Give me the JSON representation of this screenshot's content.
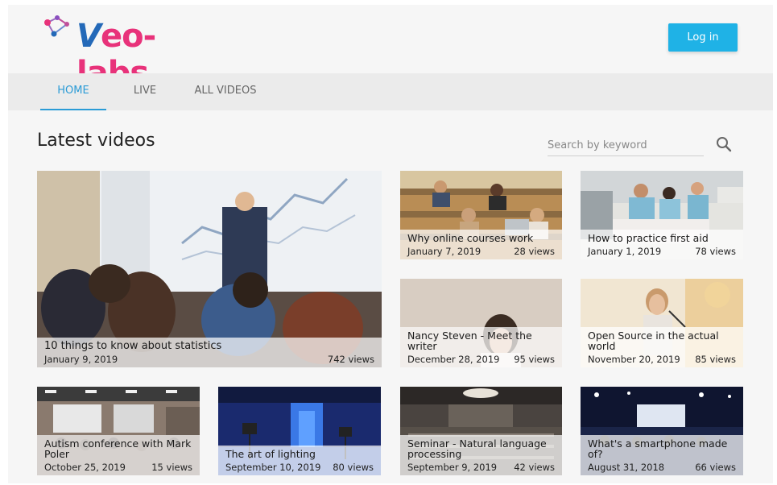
{
  "brand": {
    "logo_v": "V",
    "logo_rest": "eo-labs"
  },
  "header": {
    "login_label": "Log in"
  },
  "nav": {
    "tabs": [
      {
        "label": "HOME"
      },
      {
        "label": "LIVE"
      },
      {
        "label": "ALL VIDEOS"
      }
    ]
  },
  "main": {
    "section_title": "Latest videos"
  },
  "search": {
    "placeholder": "Search by keyword"
  },
  "videos": [
    {
      "title": "10 things to know about statistics",
      "date": "January 9, 2019",
      "views": "742 views"
    },
    {
      "title": "Why online courses work",
      "date": "January 7, 2019",
      "views": "28 views"
    },
    {
      "title": "How to practice first aid",
      "date": "January 1, 2019",
      "views": "78 views"
    },
    {
      "title": "Nancy Steven - Meet the writer",
      "date": "December 28, 2019",
      "views": "95 views"
    },
    {
      "title": "Open Source in the actual world",
      "date": "November 20, 2019",
      "views": "85 views"
    },
    {
      "title": "Autism conference with Mark Poler",
      "date": "October 25, 2019",
      "views": "15 views"
    },
    {
      "title": "The art of lighting",
      "date": "September 10, 2019",
      "views": "80 views"
    },
    {
      "title": "Seminar - Natural language processing",
      "date": "September 9, 2019",
      "views": "42 views"
    },
    {
      "title": "What's a smartphone made of?",
      "date": "August 31, 2018",
      "views": "66 views"
    }
  ],
  "colors": {
    "accent": "#2a9bd6",
    "button": "#1fb2e6",
    "logo_blue": "#2469b8",
    "logo_pink": "#e8327a"
  }
}
